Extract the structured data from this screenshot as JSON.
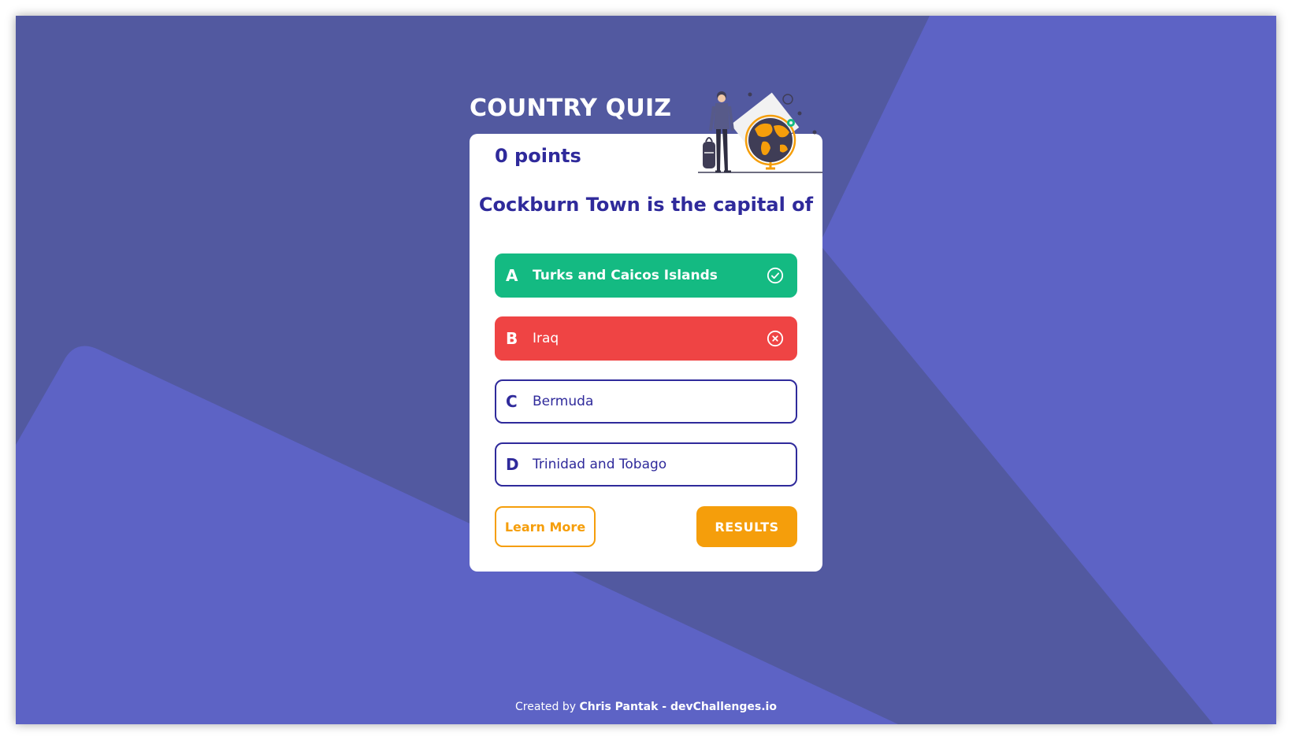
{
  "app": {
    "title": "COUNTRY QUIZ"
  },
  "score": {
    "points_label": "0 points"
  },
  "question": {
    "text": "Cockburn Town is the capital of"
  },
  "options": [
    {
      "letter": "A",
      "text": "Turks and Caicos Islands",
      "state": "correct",
      "icon": "check-circle-icon"
    },
    {
      "letter": "B",
      "text": "Iraq",
      "state": "wrong",
      "icon": "x-circle-icon"
    },
    {
      "letter": "C",
      "text": "Bermuda",
      "state": "default"
    },
    {
      "letter": "D",
      "text": "Trinidad and Tobago",
      "state": "default"
    }
  ],
  "actions": {
    "learn_more_label": "Learn More",
    "results_label": "RESULTS"
  },
  "footer": {
    "prefix": "Created by",
    "author": "Chris Pantak - devChallenges.io"
  },
  "colors": {
    "background_dark": "#5259a0",
    "background_light": "#5d63c5",
    "primary_text": "#2f2a9b",
    "correct": "#14ba82",
    "wrong": "#ef4444",
    "accent": "#f59e0b",
    "card": "#ffffff"
  }
}
